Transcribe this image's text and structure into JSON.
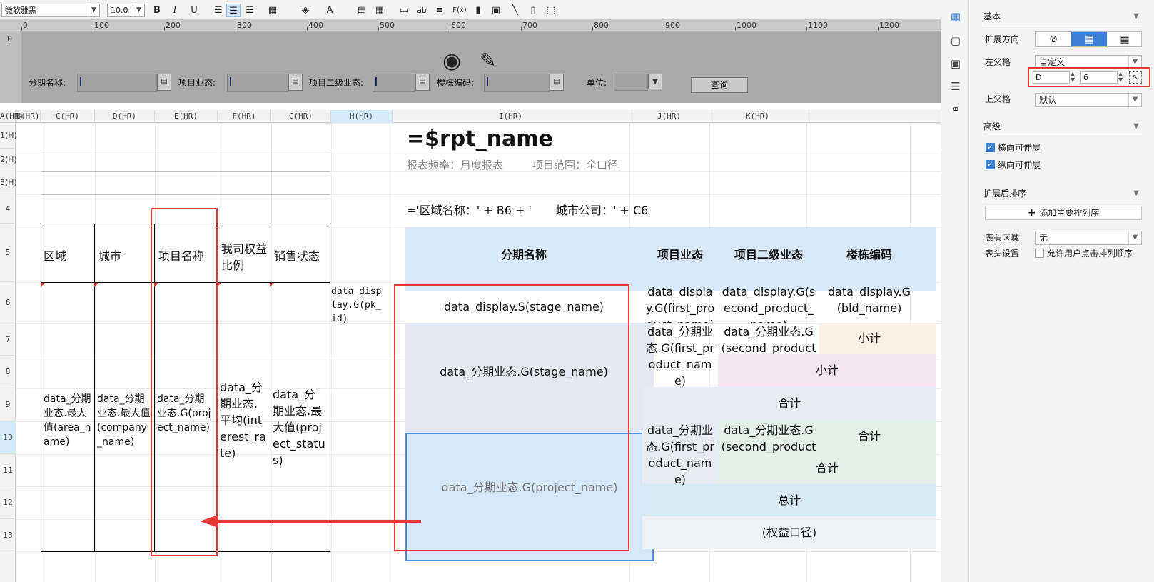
{
  "toolbar": {
    "font_name": "微软雅黑",
    "font_size": "10.0",
    "bold": "B",
    "italic": "I",
    "underline": "U",
    "icons": [
      "align-left-icon",
      "align-center-icon",
      "align-right-icon",
      "border-icon",
      "fill-color-icon",
      "font-color-icon",
      "format-painter-icon",
      "table-icon",
      "insert-column-icon",
      "text-icon",
      "wrap-icon",
      "formula-icon",
      "chart-icon",
      "image-icon",
      "slash-icon",
      "subreport-icon",
      "more-icon"
    ],
    "formula_label": "F(x)",
    "text_label": "ab"
  },
  "ruler": {
    "ticks": [
      "0",
      "100",
      "200",
      "300",
      "400",
      "500",
      "600",
      "700",
      "800",
      "900",
      "1000",
      "1100",
      "1200"
    ],
    "vruler_label": "0"
  },
  "params": {
    "fields": [
      {
        "label": "分期名称:"
      },
      {
        "label": "项目业态:"
      },
      {
        "label": "项目二级业态:"
      },
      {
        "label": "楼栋编码:"
      },
      {
        "label": "单位:"
      }
    ],
    "query_label": "查询",
    "icons": [
      "hidden-eye-icon",
      "edit-pencil-icon"
    ]
  },
  "columns": [
    "A(HR)",
    "B(HR)",
    "C(HR)",
    "D(HR)",
    "E(HR)",
    "F(HR)",
    "G(HR)",
    "H(HR)",
    "I(HR)",
    "J(HR)",
    "K(HR)"
  ],
  "rows": [
    "1(H)",
    "2(H)",
    "3(H)",
    "4",
    "5",
    "6",
    "7",
    "8",
    "9",
    "10",
    "11",
    "12",
    "13"
  ],
  "sheet": {
    "title": "=$rpt_name",
    "subtitle_freq": "报表频率：月度报表",
    "subtitle_scope": "项目范围：全口径",
    "region_formula_a": "='区域名称：' + B6 + '",
    "region_formula_b": "城市公司：' + C6",
    "headers_left": [
      "区域",
      "城市",
      "项目名称",
      "我司权益比例",
      "销售状态"
    ],
    "headers_right": [
      "分期名称",
      "项目业态",
      "项目二级业态",
      "楼栋编码"
    ],
    "b6": "data_分期业态.最大值(area_name)",
    "c6": "data_分期业态.最大值(company_name)",
    "d6": "data_分期业态.G(project_name)",
    "e6": "data_分期业态.平均(interest_rate)",
    "f6": "data_分期业态.最大值(project_status)",
    "g6": "data_display.G(pk_id)",
    "h6": "data_display.S(stage_name)",
    "i6": "data_display.G(first_product_name)",
    "j6": "data_display.G(second_product_name)",
    "k6": "data_display.G(bld_name)",
    "h7": "data_分期业态.G(stage_name)",
    "i7": "data_分期业态.G(first_product_name)",
    "j7": "data_分期业态.G(second_product_name)",
    "k7": "小计",
    "j8": "小计",
    "i9": "合计",
    "h10": "data_分期业态.G(project_name)",
    "i10": "data_分期业态.G(first_product_name)",
    "j10": "data_分期业态.G(second_product_name)",
    "k10": "合计",
    "j11": "合计",
    "i12": "总计",
    "i13": "(权益口径)"
  },
  "panel": {
    "section_basic": "基本",
    "expand_dir_label": "扩展方向",
    "left_parent_label": "左父格",
    "left_parent_value": "自定义",
    "left_parent_col": "D",
    "left_parent_row": "6",
    "top_parent_label": "上父格",
    "top_parent_value": "默认",
    "section_adv": "高级",
    "h_expand": "横向可伸展",
    "v_expand": "纵向可伸展",
    "section_sort": "扩展后排序",
    "add_sort": "添加主要排列序",
    "header_area_label": "表头区域",
    "header_area_value": "无",
    "header_setting_label": "表头设置",
    "allow_sort": "允许用户点击排列顺序",
    "icons": [
      "cell-attr-icon",
      "cell-style-icon",
      "widget-icon",
      "filter-icon",
      "link-icon"
    ]
  },
  "colors": {
    "header_blue": "#d9e8f6",
    "highlight_red": "#e53935",
    "selected_blue": "#d6e8f7"
  }
}
